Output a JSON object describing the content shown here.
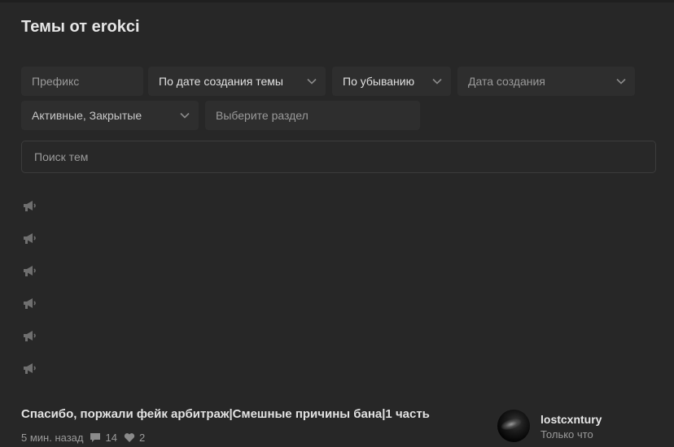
{
  "page": {
    "title": "Темы от erokci"
  },
  "filters": {
    "prefix": {
      "placeholder": "Префикс"
    },
    "sort_by": {
      "value": "По дате создания темы"
    },
    "order": {
      "value": "По убыванию"
    },
    "date": {
      "placeholder": "Дата создания"
    },
    "state": {
      "value": "Активные, Закрытые"
    },
    "section": {
      "placeholder": "Выберите раздел"
    }
  },
  "search": {
    "placeholder": "Поиск тем"
  },
  "sticky_icons": [
    "megaphone-icon",
    "megaphone-icon",
    "megaphone-icon",
    "megaphone-icon",
    "megaphone-icon",
    "megaphone-icon"
  ],
  "thread": {
    "title": "Спасибо, поржали фейк арбитраж|Смешные причины бана|1 часть",
    "time": "5 мин. назад",
    "replies": "14",
    "likes": "2",
    "last_user": "lostcxntury",
    "last_activity": "Только что"
  },
  "colors": {
    "background": "#272727",
    "control": "#2e2e2e",
    "text": "#d6d6d6",
    "muted": "#9a9a9a"
  }
}
